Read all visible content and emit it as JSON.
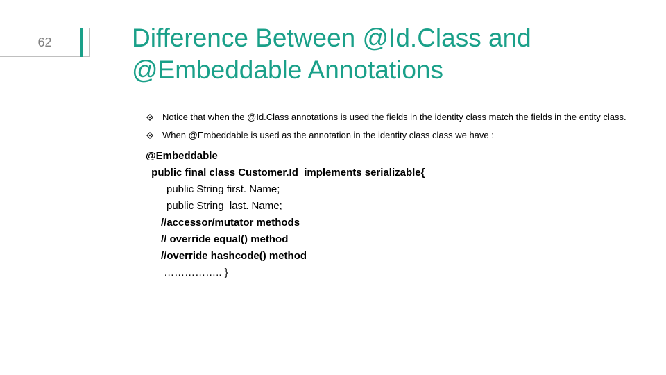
{
  "page_number": "62",
  "title": "Difference Between @Id.Class and @Embeddable Annotations",
  "bullets": [
    "Notice that when the @Id.Class annotations is used the fields in the identity class match the fields in the entity class.",
    "When @Embeddable is used as the annotation in the identity class class we have :"
  ],
  "code": {
    "l0": "@Embeddable",
    "l1": " public final class Customer.Id  implements serializable{",
    "l2": "public String first. Name;",
    "l3": "public String  last. Name;",
    "l4": "//accessor/mutator methods",
    "l5": "// override equal() method",
    "l6": "//override hashcode() method",
    "l7": " …………….. }"
  }
}
